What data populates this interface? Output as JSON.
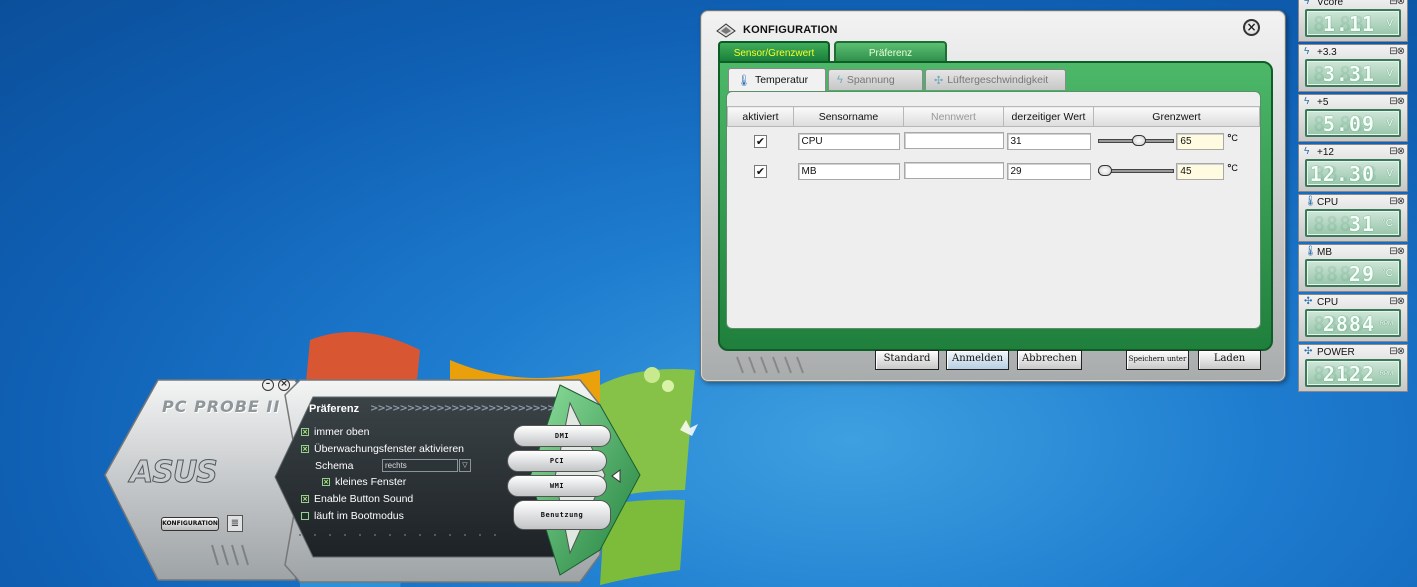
{
  "config": {
    "title": "KONFIGURATION",
    "tabs": [
      "Sensor/Grenzwert",
      "Präferenz"
    ],
    "subtabs": [
      "Temperatur",
      "Spannung",
      "Lüftergeschwindigkeit"
    ],
    "columns": [
      "aktiviert",
      "Sensorname",
      "Nennwert",
      "derzeitiger Wert",
      "Grenzwert"
    ],
    "rows": [
      {
        "checked": "✔",
        "name": "CPU",
        "nominal": "",
        "current": "31",
        "limit": "65",
        "unit": "C",
        "slider_fraction": 0.55
      },
      {
        "checked": "✔",
        "name": "MB",
        "nominal": "",
        "current": "29",
        "limit": "45",
        "unit": "C",
        "slider_fraction": 0.0
      }
    ],
    "buttons": [
      "Standard",
      "Anmelden",
      "Abbrechen",
      "Speichern unter",
      "Laden"
    ]
  },
  "monitors": [
    {
      "label": "Vcore",
      "value": "1.11",
      "unit": "V",
      "ghost": "8.88",
      "icon": "voltage-icon"
    },
    {
      "label": "+3.3",
      "value": "3.31",
      "unit": "V",
      "ghost": "8.88",
      "icon": "voltage-icon"
    },
    {
      "label": "+5",
      "value": "5.09",
      "unit": "V",
      "ghost": "8.88",
      "icon": "voltage-icon"
    },
    {
      "label": "+12",
      "value": "12.30",
      "unit": "V",
      "ghost": "88.88",
      "icon": "voltage-icon"
    },
    {
      "label": "CPU",
      "value": "31",
      "unit": "°C",
      "ghost": "888",
      "icon": "thermometer-icon"
    },
    {
      "label": "MB",
      "value": "29",
      "unit": "°C",
      "ghost": "888",
      "icon": "thermometer-icon"
    },
    {
      "label": "CPU",
      "value": "2884",
      "unit": "RPM",
      "ghost": "8888",
      "icon": "fan-icon"
    },
    {
      "label": "POWER",
      "value": "2122",
      "unit": "RPM",
      "ghost": "8888",
      "icon": "fan-icon"
    }
  ],
  "probe": {
    "brand": "PC PROBE II",
    "logo": "ASUS",
    "config_button": "KONFIGURATION",
    "panel_title": "Präferenz",
    "options": {
      "always_on_top": "immer oben",
      "monitor_windows": "Überwachungsfenster aktivieren",
      "schema_label": "Schema",
      "schema_value": "rechts",
      "small_window": "kleines Fenster",
      "button_sound": "Enable Button Sound",
      "boot_mode": "läuft im Bootmodus"
    },
    "side_buttons": [
      "DMI",
      "PCI",
      "WMI",
      "Benutzung"
    ]
  },
  "colors": {
    "accent_green": "#1f7f3c",
    "active_tab_text": "#f5ff2a",
    "lcd_bg": "#98c6ab",
    "desktop_blue": "#1e7ccf"
  }
}
